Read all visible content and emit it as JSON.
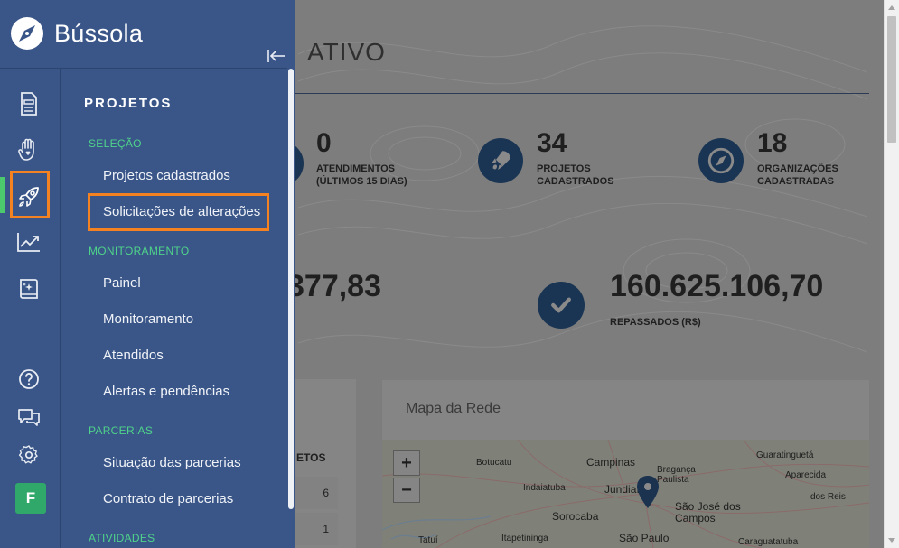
{
  "sidebar": {
    "brand": "Bússola",
    "menu_title": "PROJETOS",
    "sections": [
      {
        "label": "SELEÇÃO",
        "items": [
          "Projetos cadastrados",
          "Solicitações de alterações"
        ]
      },
      {
        "label": "MONITORAMENTO",
        "items": [
          "Painel",
          "Monitoramento",
          "Atendidos",
          "Alertas e pendências"
        ]
      },
      {
        "label": "PARCERIAS",
        "items": [
          "Situação das parcerias",
          "Contrato de parcerias"
        ]
      },
      {
        "label": "ATIVIDADES",
        "items": []
      }
    ],
    "rail_icons": [
      "document-icon",
      "hand-heart-icon",
      "rocket-icon",
      "chart-trend-icon",
      "sparkle-book-icon",
      "help-icon",
      "chat-icon",
      "gear-icon"
    ],
    "avatar_letter": "F",
    "active_rail": "rocket-icon"
  },
  "dashboard": {
    "title_fragment": "ATIVO",
    "stats": [
      {
        "value": "0",
        "label": "ATENDIMENTOS (ÚLTIMOS 15 DIAS)",
        "icon": "person-icon"
      },
      {
        "value": "34",
        "label": "PROJETOS CADASTRADOS",
        "icon": "rocket-icon"
      },
      {
        "value": "18",
        "label": "ORGANIZAÇÕES CADASTRADAS",
        "icon": "compass-icon"
      }
    ],
    "big_left_value": "377,83",
    "big_right": {
      "value": "160.625.106,70",
      "label": "REPASSADOS (R$)",
      "icon": "check-icon"
    },
    "table": {
      "header_fragment": "ETOS",
      "rows": [
        "6",
        "1"
      ]
    },
    "map": {
      "title": "Mapa da Rede",
      "zoom_in": "+",
      "zoom_out": "−",
      "cities": [
        "Botucatu",
        "Campinas",
        "Bragança Paulista",
        "Guaratinguetá",
        "Indaiatuba",
        "Jundiaí",
        "Aparecida",
        "Sorocaba",
        "São José dos Campos",
        "dos Reis",
        "Itapetininga",
        "São Paulo",
        "Caraguatatuba",
        "Tatuí"
      ]
    }
  }
}
